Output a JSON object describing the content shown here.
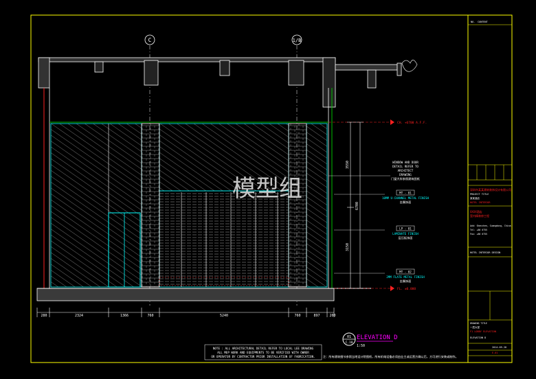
{
  "watermark": "模型组",
  "grid_labels": [
    "C",
    "1/B"
  ],
  "annotations": [
    {
      "tag": "",
      "lines": [
        "WINDOW AND DOOR",
        "DETAIL REFER TO",
        "ARCHITECT",
        "DRAWING",
        "门窗大样参照建筑图纸"
      ]
    },
    {
      "tag": "MT - 01",
      "lines": [
        "10MM U-CHANNEL METAL FINISH",
        "金属饰面"
      ]
    },
    {
      "tag": "LP - 01",
      "lines": [
        "LAMINATE FINISH",
        "层压板饰面"
      ]
    },
    {
      "tag": "MT - 02",
      "lines": [
        "2MM FLATE METAL FINISH",
        "金属饰面"
      ]
    }
  ],
  "level_markers": {
    "ceiling": "CH. +6700 A.F.F.",
    "floor": "FL. ±0.000"
  },
  "vertical_dims": [
    "3550",
    "6700",
    "3150"
  ],
  "horizontal_dims": [
    "280",
    "2324",
    "1366",
    "760",
    "5240",
    "760",
    "897",
    "200"
  ],
  "elevation": {
    "title": "ELEVATION D",
    "circle_top": "01",
    "circle_bottom": "C.10",
    "scale": "1:50"
  },
  "notes": [
    "NOTE : ALL ARCHITECTURAL DETAIL REFER TO LOCAL LEE DRAWING",
    "ALL MEP WORK AND EQUIPMENTS TO BE VERIFIED WITH OWNER",
    "OR OPERATOR BY CONTRACTOR PRIOR INSTALLATION OF FABRICATION."
  ],
  "footer_note": "注：所有建筑细节参照当地设计院图纸，所有机电设备必须由业主或运营方确认后，方可进行安装或制作。",
  "title_block": {
    "top_cells": [
      "NO.",
      "CONTENT"
    ],
    "company_cn": "深圳市某某建筑装饰设计有限公司",
    "company_en": "PROJECT TITLE",
    "project_cn": "某某酒店",
    "project_en": "HOTEL INTERIOR",
    "project_red": [
      "XXXX酒店",
      "室内精装修工程"
    ],
    "address": [
      "Add: Shenzhen, Guangdong, China",
      "Tel: +86 0755",
      "Fax: +86 0755"
    ],
    "design_label": "HOTEL INTERIOR DESIGN",
    "drawing_label": "DRAWING TITLE",
    "drawing_cn": "一层大堂",
    "drawing_red": "F1 LOBBY ELEVATION",
    "drawing_en": "ELEVATION D",
    "date": "2014.09.28",
    "sheet_no": "E-01"
  },
  "colors": {
    "background": "#000000",
    "border": "#ffff00",
    "line_white": "#ffffff",
    "line_cyan": "#00ffff",
    "line_green": "#00c000",
    "line_red": "#ff2020",
    "magenta": "#ff00ff",
    "watermark": "#e6e6e6"
  }
}
